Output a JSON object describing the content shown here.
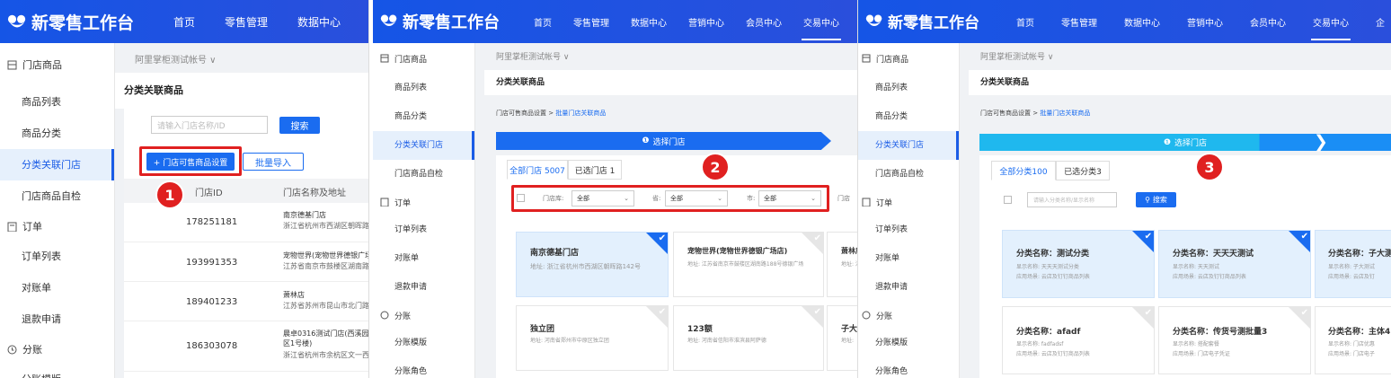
{
  "app_title": "新零售工作台",
  "nav": [
    "首页",
    "零售管理",
    "数据中心",
    "营销中心",
    "会员中心",
    "交易中心",
    "企"
  ],
  "nav_p1": [
    "首页",
    "零售管理",
    "数据中心",
    "营"
  ],
  "sidebar": {
    "group_goods": "门店商品",
    "goods_items": [
      "商品列表",
      "商品分类",
      "分类关联门店",
      "门店商品自检"
    ],
    "group_orders": "订单",
    "order_items": [
      "订单列表",
      "对账单",
      "退款申请"
    ],
    "group_split": "分账",
    "split_items": [
      "分账模版",
      "分账角色"
    ]
  },
  "account": "阿里掌柜测试帐号 ∨",
  "page_title": "分类关联商品",
  "panel1": {
    "search_placeholder": "请输入门店名称/ID",
    "search_btn": "搜索",
    "setting_btn": "+ 门店可售商品设置",
    "import_btn": "批量导入",
    "col_id": "门店ID",
    "col_name": "门店名称及地址",
    "rows": [
      {
        "id": "178251181",
        "name": "南京德基门店",
        "addr": "浙江省杭州市西湖区朝晖路"
      },
      {
        "id": "193991353",
        "name": "宠物世界(宠物世界德银广场店)",
        "addr": "江苏省南京市鼓楼区湖南路"
      },
      {
        "id": "189401233",
        "name": "萧林店",
        "addr": "江苏省苏州市昆山市北门路"
      },
      {
        "id": "186303078",
        "name": "晨卓0316测试门店(西溪园区1号楼)",
        "addr": "浙江省杭州市余杭区文一西"
      }
    ],
    "badge": "1"
  },
  "panel2": {
    "crumb_parent": "门店可售商品设置",
    "crumb_current": "批量门店关联商品",
    "step": "选择门店",
    "tab_all": "全部门店 5007",
    "tab_sel": "已选门店 1",
    "f_store_label": "门店库:",
    "f_province_label": "省:",
    "f_city_label": "市:",
    "f_all": "全部",
    "f_more": "门店",
    "badge": "2",
    "cards": [
      {
        "title": "南京德基门店",
        "addr": "地址: 浙江省杭州市西湖区朝晖路142号"
      },
      {
        "title": "宠物世界(宠物世界德银广场店)",
        "addr": "地址: 江苏省南京市鼓楼区湖南路188号德银广场"
      },
      {
        "title": "萧林店",
        "addr": "地址: 江苏省苏州市昆山市北门路交叉口"
      },
      {
        "title": "独立团",
        "addr": "地址: 河南省郑州市中原区独立团"
      },
      {
        "title": "123额",
        "addr": "地址: 河南省信阳市淮滨县阿萨德"
      },
      {
        "title": "子大",
        "addr": "地址:"
      }
    ]
  },
  "panel3": {
    "step": "选择门店",
    "tab_all": "全部分类100",
    "tab_sel": "已选分类3",
    "search_placeholder": "请输入分类名称/显示名称",
    "search_btn": "搜索",
    "badge": "3",
    "cards": [
      {
        "title": "分类名称：测试分类",
        "l1": "显示名称: 天天天测试分类",
        "l2": "应用场景: 云店及钉钉商品列表"
      },
      {
        "title": "分类名称：天天天测试",
        "l1": "显示名称: 天天测试",
        "l2": "应用场景: 云店及钉钉商品列表"
      },
      {
        "title": "分类名称：子大测",
        "l1": "显示名称: 子大测试",
        "l2": "应用场景: 云店及钉"
      },
      {
        "title": "分类名称：afadf",
        "l1": "显示名称: fadfadsf",
        "l2": "应用场景: 云店及钉钉商品列表"
      },
      {
        "title": "分类名称：传货号测批量3",
        "l1": "显示名称: 搭配套餐",
        "l2": "应用场景: 门店电子凭证"
      },
      {
        "title": "分类名称：主体4",
        "l1": "显示名称: 门店优惠",
        "l2": "应用场景: 门店电子"
      }
    ]
  }
}
